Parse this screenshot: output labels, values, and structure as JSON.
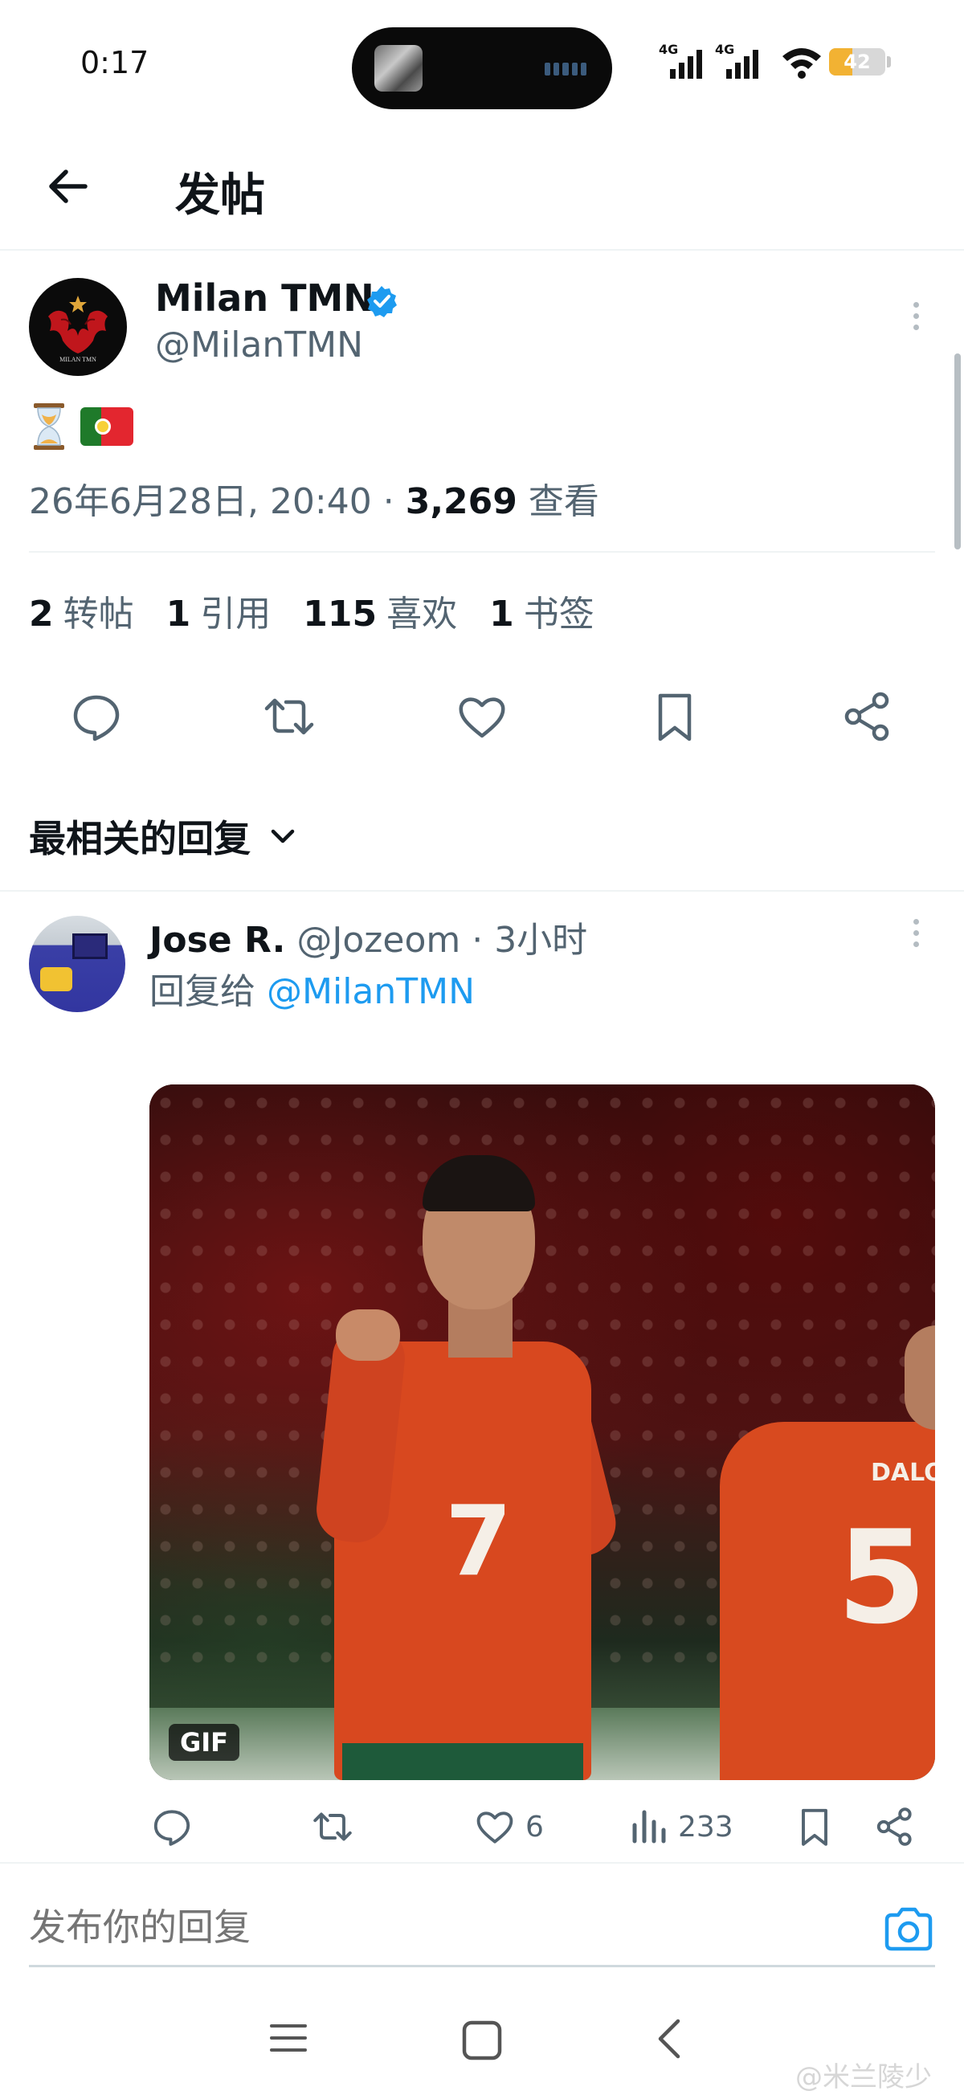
{
  "status_bar": {
    "time": "0:17",
    "signal1_label": "4G",
    "signal2_label": "4G",
    "battery_level": 42,
    "battery_text": "42",
    "accent_color": "#f2b233"
  },
  "header": {
    "back_icon": "arrow-left-icon",
    "title": "发帖"
  },
  "tweet": {
    "author_name": "Milan TMN",
    "verified_icon": "verified-badge-icon",
    "author_handle": "@MilanTMN",
    "content_emoji": [
      "hourglass-icon",
      "portugal-flag-icon"
    ],
    "datetime": "26年6月28日, 20:40",
    "meta_sep": " · ",
    "views_count": "3,269",
    "views_label": "查看",
    "stats": {
      "reposts_count": "2",
      "reposts_label": "转帖",
      "quotes_count": "1",
      "quotes_label": "引用",
      "likes_count": "115",
      "likes_label": "喜欢",
      "bookmarks_count": "1",
      "bookmarks_label": "书签"
    },
    "actions": [
      "reply-icon",
      "retweet-icon",
      "heart-icon",
      "bookmark-icon",
      "share-icon"
    ]
  },
  "sort": {
    "label": "最相关的回复",
    "icon": "chevron-down-icon"
  },
  "reply": {
    "name": "Jose R.",
    "handle": "@Jozeom",
    "sep": " · ",
    "time": "3小时",
    "reply_to_label": "回复给",
    "reply_to_user": "@MilanTMN",
    "media_badge": "GIF",
    "likes": "6",
    "views": "233",
    "actions": [
      "reply-icon",
      "retweet-icon",
      "heart-icon",
      "views-icon",
      "bookmark-icon",
      "share-icon"
    ]
  },
  "composer": {
    "placeholder": "发布你的回复",
    "camera_icon": "camera-icon",
    "accent": "#1d9bf0"
  },
  "nav_bar": {
    "icons": [
      "menu-icon",
      "home-square-icon",
      "back-chevron-icon"
    ]
  },
  "watermark": "@米兰陵少"
}
